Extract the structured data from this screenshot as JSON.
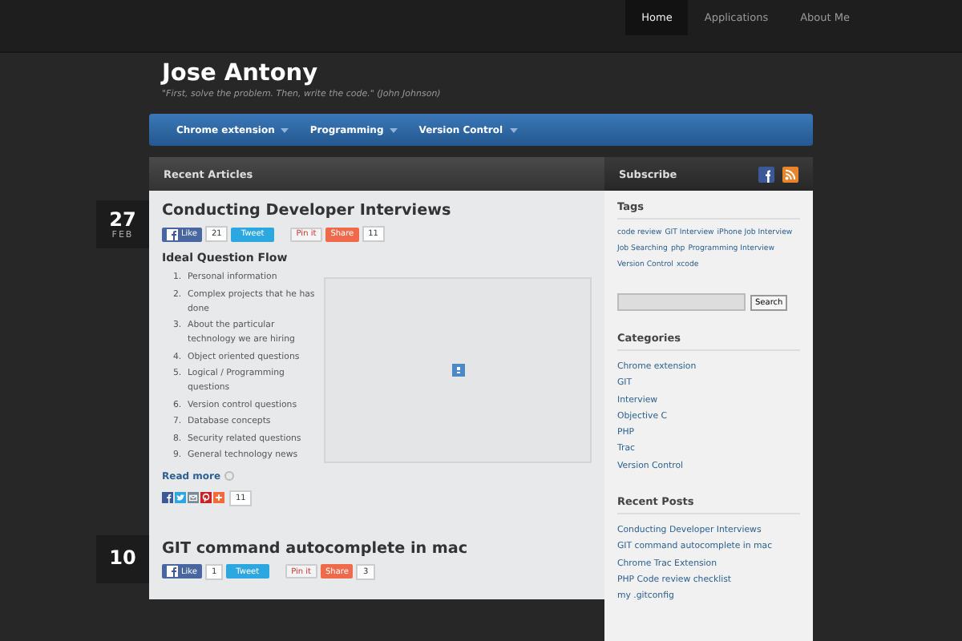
{
  "top_nav": [
    {
      "label": "Home",
      "selected": true
    },
    {
      "label": "Applications",
      "selected": false
    },
    {
      "label": "About Me",
      "selected": false
    }
  ],
  "site": {
    "title": "Jose Antony",
    "tagline": "\"First, solve the problem. Then, write the code.\" (John Johnson)"
  },
  "menu": [
    "Chrome extension",
    "Programming",
    "Version Control"
  ],
  "main": {
    "heading": "Recent Articles",
    "articles": [
      {
        "day": "27",
        "month": "FEB",
        "title": "Conducting Developer Interviews",
        "social": {
          "like": "Like",
          "like_count": "21",
          "tweet": "Tweet",
          "pin": "Pin it",
          "share": "Share",
          "share_count": "11"
        },
        "subheading": "Ideal Question Flow",
        "list": [
          {
            "num": "1.",
            "text": "Personal information"
          },
          {
            "num": "2.",
            "text": "Complex projects that he has done"
          },
          {
            "num": "3.",
            "text": "About the particular technology we are hiring"
          },
          {
            "num": "4.",
            "text": "Object oriented questions"
          },
          {
            "num": "5.",
            "text": "Logical / Programming questions"
          },
          {
            "num": "6.",
            "text": "Version control questions"
          },
          {
            "num": "7.",
            "text": "Database concepts"
          },
          {
            "num": "8.",
            "text": "Security related questions"
          },
          {
            "num": "9.",
            "text": "General technology news"
          }
        ],
        "read_more": "Read more",
        "share_total": "11"
      },
      {
        "day": "10",
        "title": "GIT command autocomplete in mac",
        "social": {
          "like": "Like",
          "like_count": "1",
          "tweet": "Tweet",
          "pin": "Pin it",
          "share": "Share",
          "share_count": "3"
        }
      }
    ]
  },
  "sidebar": {
    "heading": "Subscribe",
    "widgets": [
      {
        "kind": "tags",
        "title": "Tags",
        "items": [
          "code review",
          "GIT Interview",
          "iPhone Job Interview",
          "Job Searching",
          "php",
          "Programming Interview",
          "Version Control",
          "xcode"
        ]
      },
      {
        "kind": "search",
        "button": "Search"
      },
      {
        "kind": "links",
        "title": "Categories",
        "items": [
          "Chrome extension",
          "GIT",
          "Interview",
          "Objective C",
          "PHP",
          "Trac",
          "Version Control"
        ]
      },
      {
        "kind": "links",
        "title": "Recent Posts",
        "items": [
          "Conducting Developer Interviews",
          "GIT command autocomplete in mac",
          "Chrome Trac Extension",
          "PHP Code review checklist",
          "my .gitconfig"
        ]
      }
    ]
  }
}
